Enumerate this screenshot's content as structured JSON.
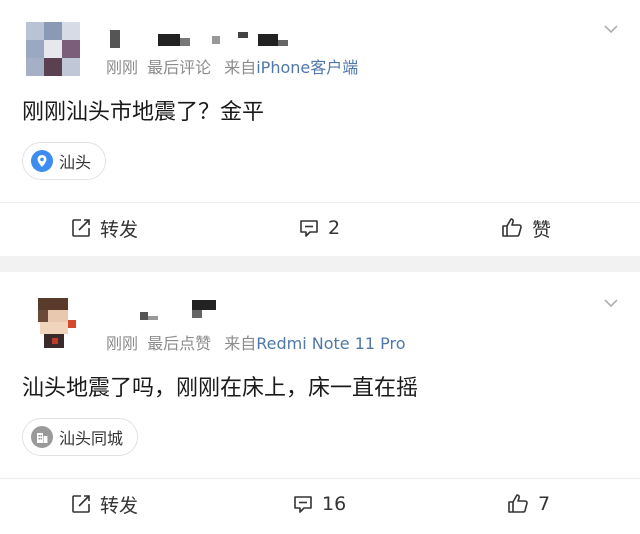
{
  "posts": [
    {
      "time": "刚刚",
      "activity": "最后评论",
      "source_prefix": "来自",
      "source_app": "iPhone客户端",
      "content": "刚刚汕头市地震了？金平",
      "tag": {
        "label": "汕头",
        "icon": "location-pin-icon"
      },
      "actions": {
        "repost": "转发",
        "comment": "2",
        "like": "赞"
      }
    },
    {
      "time": "刚刚",
      "activity": "最后点赞",
      "source_prefix": "来自",
      "source_app": "Redmi Note 11 Pro",
      "content": "汕头地震了吗，刚刚在床上，床一直在摇",
      "tag": {
        "label": "汕头同城",
        "icon": "city-building-icon"
      },
      "actions": {
        "repost": "转发",
        "comment": "16",
        "like": "7"
      }
    }
  ],
  "colors": {
    "source_link": "#5077aa",
    "meta_gray": "#8c8c8c",
    "location_blue": "#3d8cf0",
    "divider": "#f2f2f2"
  }
}
